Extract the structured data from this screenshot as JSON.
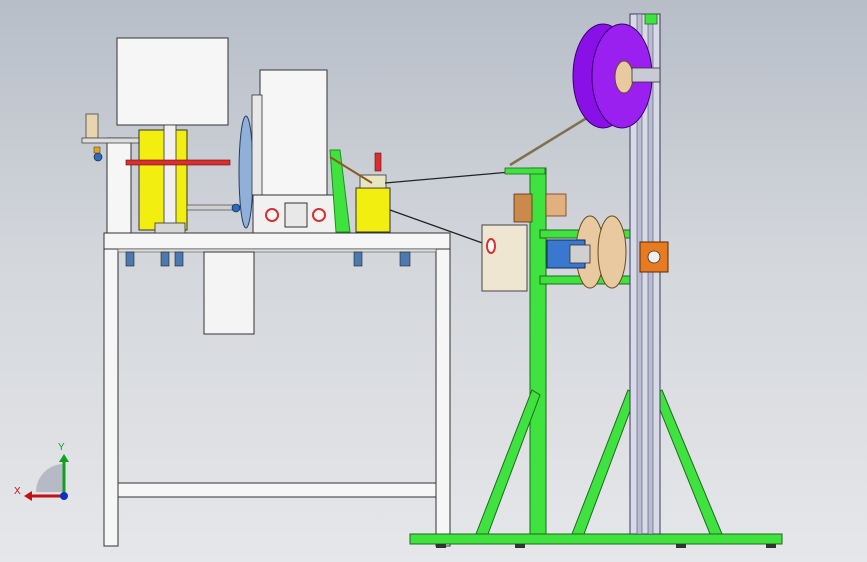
{
  "viewport": {
    "background_top": "#b7bec8",
    "background_bottom": "#e6e7ea"
  },
  "colors": {
    "frame_green": "#3fe23f",
    "frame_green_dark": "#1e8f1e",
    "spool_purple": "#8a10e8",
    "spool_purple_dark": "#5a08a8",
    "component_yellow": "#f2ee10",
    "table_white": "#f6f6f6",
    "motor_blue": "#3a78d0",
    "accent_red": "#d83030",
    "housing_orange": "#e87a20",
    "reel_tan": "#e8c9a0",
    "wood_brown": "#c98a4a"
  },
  "orientation_triad": {
    "x_label": "X",
    "y_label": "Y",
    "x_color": "#c41010",
    "y_color": "#10a020",
    "z_color": "#1030c0"
  }
}
